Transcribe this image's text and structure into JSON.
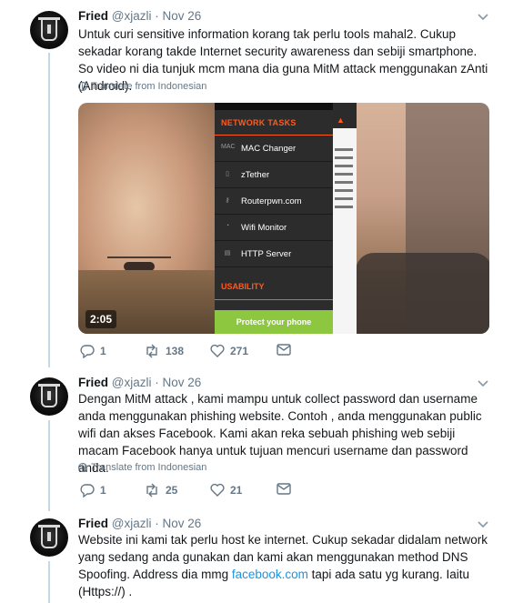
{
  "tweets": [
    {
      "name": "Fried",
      "handle": "@xjazli",
      "sep": "·",
      "date": "Nov 26",
      "text": "Untuk curi sensitive information korang tak perlu tools mahal2. Cukup sekadar korang takde Internet security awareness dan sebiji smartphone. So video ni dia tunjuk mcm mana dia guna MitM attack menggunakan zAnti (Android).",
      "translate": "Translate from Indonesian",
      "replies": "1",
      "retweets": "138",
      "likes": "271"
    },
    {
      "name": "Fried",
      "handle": "@xjazli",
      "sep": "·",
      "date": "Nov 26",
      "text": "Dengan MitM attack , kami mampu untuk collect password dan username anda menggunakan phishing website. Contoh , anda menggunakan public wifi dan akses Facebook. Kami akan reka sebuah phishing web sebiji macam Facebook hanya untuk tujuan mencuri username dan password anda.",
      "translate": "Translate from Indonesian",
      "replies": "1",
      "retweets": "25",
      "likes": "21"
    },
    {
      "name": "Fried",
      "handle": "@xjazli",
      "sep": "·",
      "date": "Nov 26",
      "text_before": "Website ini kami tak perlu host ke internet. Cukup sekadar didalam network yang sedang anda gunakan dan kami akan menggunakan method DNS Spoofing. Address dia mmg ",
      "text_link": "facebook.com",
      "text_after": " tapi ada satu yg kurang. Iaitu (Https://) ."
    }
  ],
  "video": {
    "duration": "2:05",
    "section_title": "NETWORK TASKS",
    "menu": [
      "MAC Changer",
      "zTether",
      "Routerpwn.com",
      "Wifi Monitor",
      "HTTP Server"
    ],
    "usability": "USABILITY",
    "protect_button": "Protect your phone"
  },
  "colors": {
    "accent": "#1b95e0",
    "muted": "#657786",
    "thread_line": "#c4d8e6",
    "app_orange": "#ff5a1f",
    "protect_green": "#8dc63f"
  },
  "icons": [
    "caret-down-icon",
    "globe-icon",
    "reply-icon",
    "retweet-icon",
    "like-icon",
    "message-icon"
  ]
}
